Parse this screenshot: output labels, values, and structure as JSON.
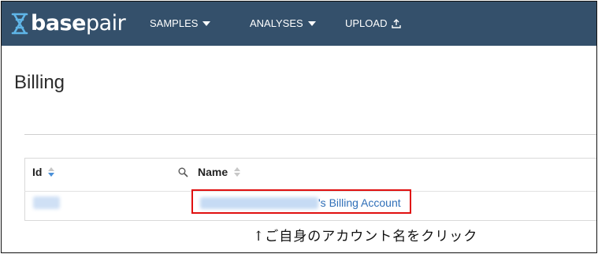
{
  "navbar": {
    "logo": {
      "bold": "base",
      "light": "pair"
    },
    "items": [
      {
        "label": "SAMPLES",
        "icon": "caret-down-icon"
      },
      {
        "label": "ANALYSES",
        "icon": "caret-down-icon"
      },
      {
        "label": "UPLOAD",
        "icon": "upload-icon"
      }
    ],
    "background": "#34506b"
  },
  "page": {
    "title": "Billing"
  },
  "table": {
    "columns": [
      {
        "label": "Id",
        "sortable": true,
        "searchable": true
      },
      {
        "label": "Name",
        "sortable": true
      }
    ],
    "rows": [
      {
        "name_suffix": "'s Billing Account"
      }
    ]
  },
  "annotation": {
    "caption": "↑ご自身のアカウント名をクリック",
    "highlight_color": "#e01010"
  }
}
